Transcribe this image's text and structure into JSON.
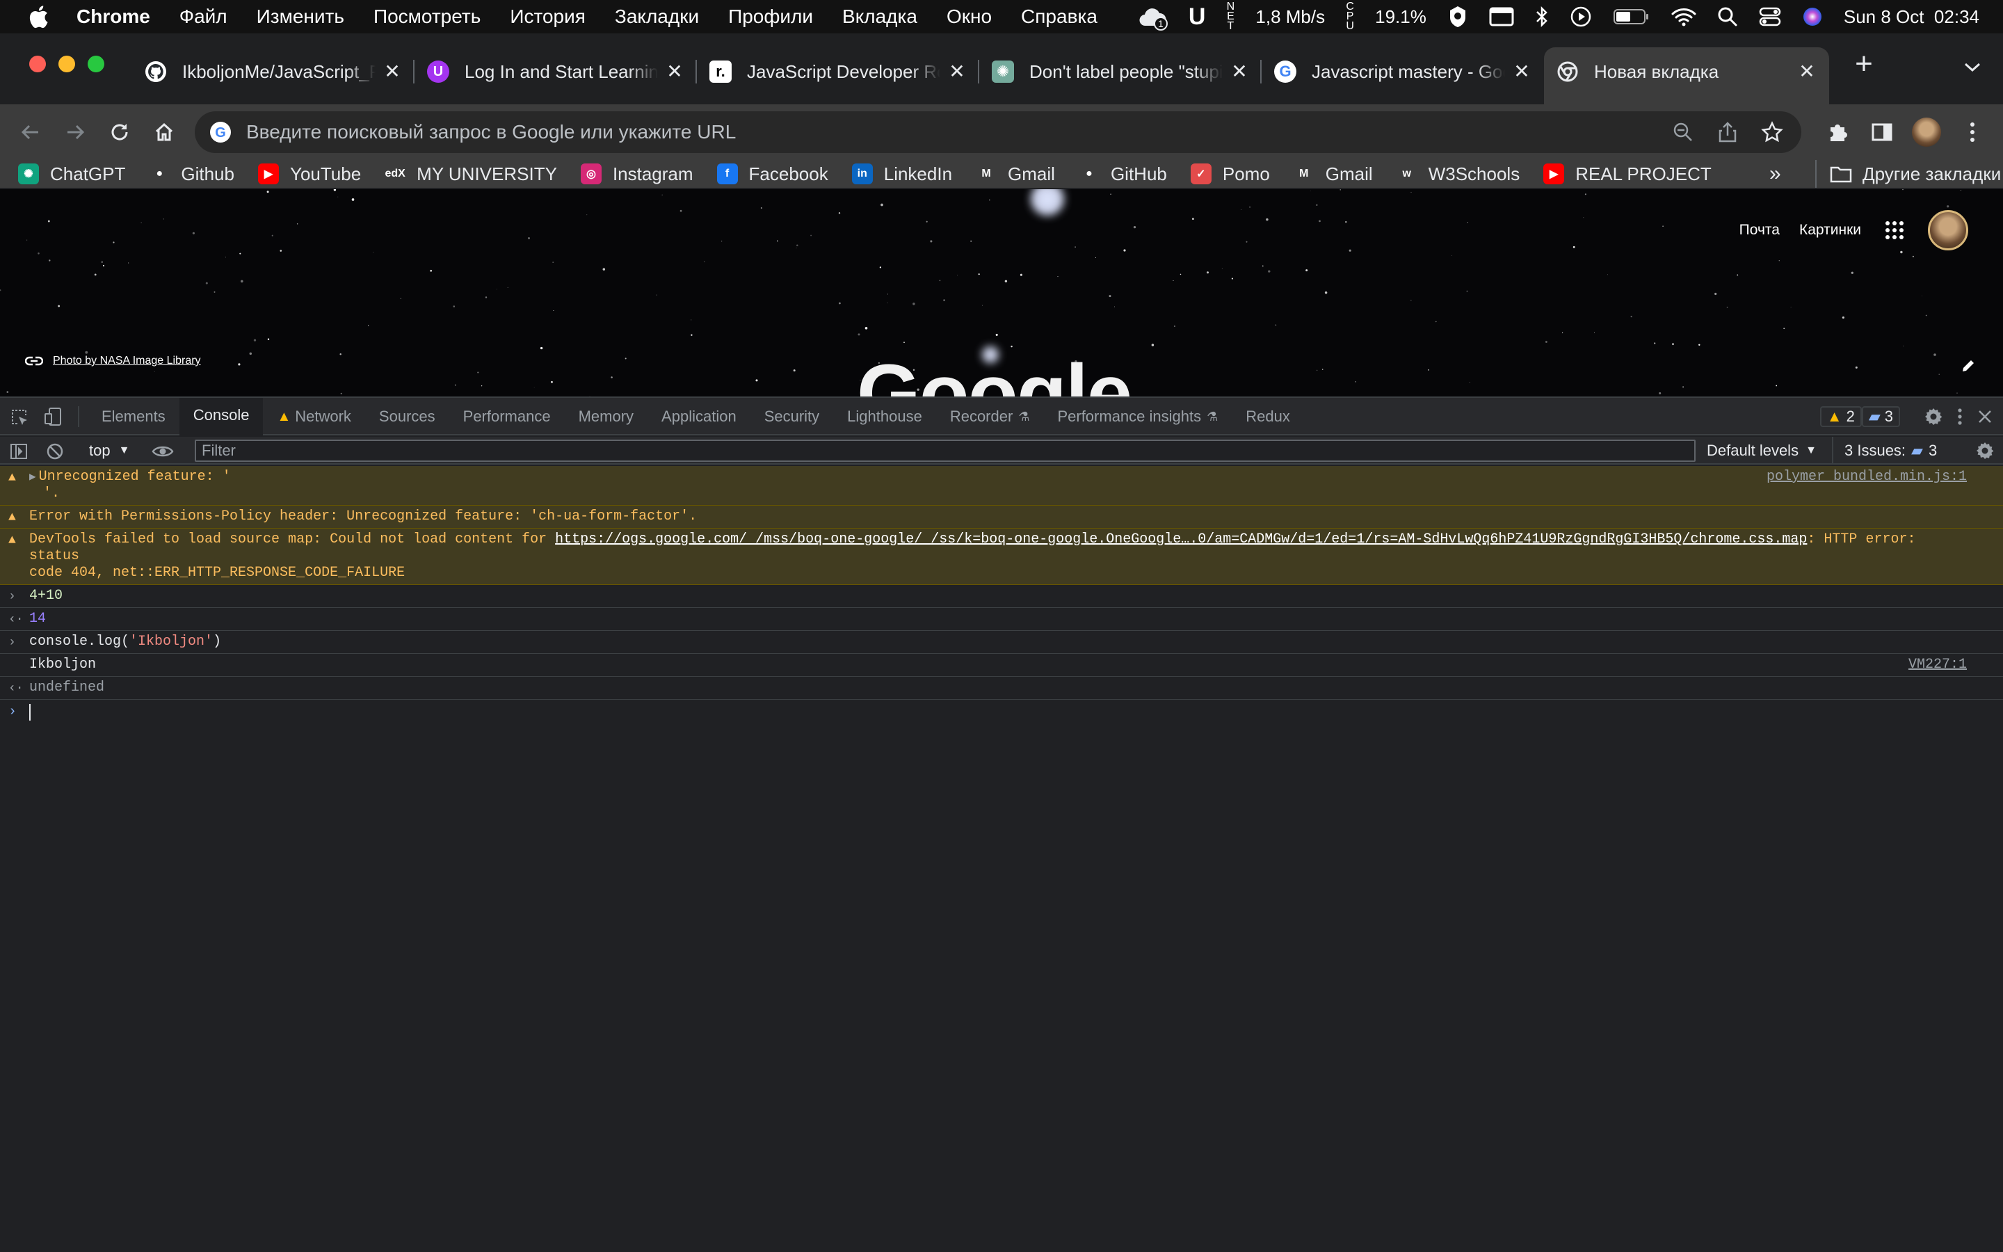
{
  "menubar": {
    "app": "Chrome",
    "items": [
      "Файл",
      "Изменить",
      "Посмотреть",
      "История",
      "Закладки",
      "Профили",
      "Вкладка",
      "Окно",
      "Справка"
    ],
    "net_speed": "1,8 Mb/s",
    "net_label": "NET",
    "cpu_label": "CPU",
    "cpu": "19.1%",
    "clock": "Sun 8 Oct  02:34",
    "notif_count": "1"
  },
  "tabs": [
    {
      "title": "IkboljonMe/JavaScript_P",
      "icon": "github-icon",
      "color": "#24292e"
    },
    {
      "title": "Log In and Start Learning",
      "icon": "udemy-icon",
      "color": "#a435f0"
    },
    {
      "title": "JavaScript Developer Ro",
      "icon": "roadmap-icon",
      "color": "#000000"
    },
    {
      "title": "Don't label people \"stupi",
      "icon": "chatgpt-icon",
      "color": "#74aa9c"
    },
    {
      "title": "Javascript mastery - Goo",
      "icon": "google-icon",
      "color": "#ffffff"
    },
    {
      "title": "Новая вкладка",
      "icon": "chrome-icon",
      "color": "#ffffff",
      "active": true
    }
  ],
  "omnibox": {
    "placeholder": "Введите поисковый запрос в Google или укажите URL"
  },
  "bookmarks": [
    {
      "label": "ChatGPT",
      "icon": "chatgpt-icon",
      "color": "#10a37f",
      "glyph": "✺"
    },
    {
      "label": "Github",
      "icon": "github-icon",
      "color": "#3c3c3c",
      "glyph": "●"
    },
    {
      "label": "YouTube",
      "icon": "youtube-icon",
      "color": "#ff0000",
      "glyph": "▶"
    },
    {
      "label": "MY UNIVERSITY",
      "icon": "edx-icon",
      "color": "#3c3c3c",
      "glyph": "edX"
    },
    {
      "label": "Instagram",
      "icon": "instagram-icon",
      "color": "#d62976",
      "glyph": "◎"
    },
    {
      "label": "Facebook",
      "icon": "facebook-icon",
      "color": "#1877f2",
      "glyph": "f"
    },
    {
      "label": "LinkedIn",
      "icon": "linkedin-icon",
      "color": "#0a66c2",
      "glyph": "in"
    },
    {
      "label": "Gmail",
      "icon": "gmail-icon",
      "color": "#3c3c3c",
      "glyph": "M"
    },
    {
      "label": "GitHub",
      "icon": "github-icon",
      "color": "#3c3c3c",
      "glyph": "●"
    },
    {
      "label": "Pomo",
      "icon": "pomo-icon",
      "color": "#e34b4b",
      "glyph": "✓"
    },
    {
      "label": "Gmail",
      "icon": "gmail-icon",
      "color": "#3c3c3c",
      "glyph": "M"
    },
    {
      "label": "W3Schools",
      "icon": "w3schools-icon",
      "color": "#3c3c3c",
      "glyph": "w"
    },
    {
      "label": "REAL PROJECT",
      "icon": "youtube-icon",
      "color": "#ff0000",
      "glyph": "▶"
    }
  ],
  "bookmarks_more": "»",
  "bookmarks_other": "Другие закладки",
  "page": {
    "links": [
      "Почта",
      "Картинки"
    ],
    "photo_credit": "Photo by NASA Image Library",
    "logo": "Google"
  },
  "devtools": {
    "tabs": [
      {
        "label": "Elements"
      },
      {
        "label": "Console",
        "active": true
      },
      {
        "label": "Network",
        "warn": true
      },
      {
        "label": "Sources"
      },
      {
        "label": "Performance"
      },
      {
        "label": "Memory"
      },
      {
        "label": "Application"
      },
      {
        "label": "Security"
      },
      {
        "label": "Lighthouse"
      },
      {
        "label": "Recorder",
        "flask": true
      },
      {
        "label": "Performance insights",
        "flask": true
      },
      {
        "label": "Redux"
      }
    ],
    "warn_count": "2",
    "msg_count": "3",
    "context": "top",
    "filter_placeholder": "Filter",
    "levels": "Default levels",
    "issues_label": "3 Issues:",
    "issues_count": "3"
  },
  "console": {
    "msg1": "Unrecognized feature: '",
    "msg1b": "'.",
    "msg1_src": "polymer_bundled.min.js:1",
    "msg2": "Error with Permissions-Policy header: Unrecognized feature: 'ch-ua-form-factor'.",
    "msg3_pre": "DevTools failed to load source map: Could not load content for ",
    "msg3_url": "https://ogs.google.com/_/mss/boq-one-google/_/ss/k=boq-one-google.OneGoogle….0/am=CADMGw/d=1/ed=1/rs=AM-SdHvLwQq6hPZ41U9RzGgndRgGI3HB5Q/chrome.css.map",
    "msg3_post": ": HTTP error: status",
    "msg3_line2": "code 404, net::ERR_HTTP_RESPONSE_CODE_FAILURE",
    "in1": "4+10",
    "out1": "14",
    "in2_fn": "console.log(",
    "in2_str": "'Ikboljon'",
    "in2_close": ")",
    "log1": "Ikboljon",
    "log1_src": "VM227:1",
    "out2": "undefined"
  }
}
